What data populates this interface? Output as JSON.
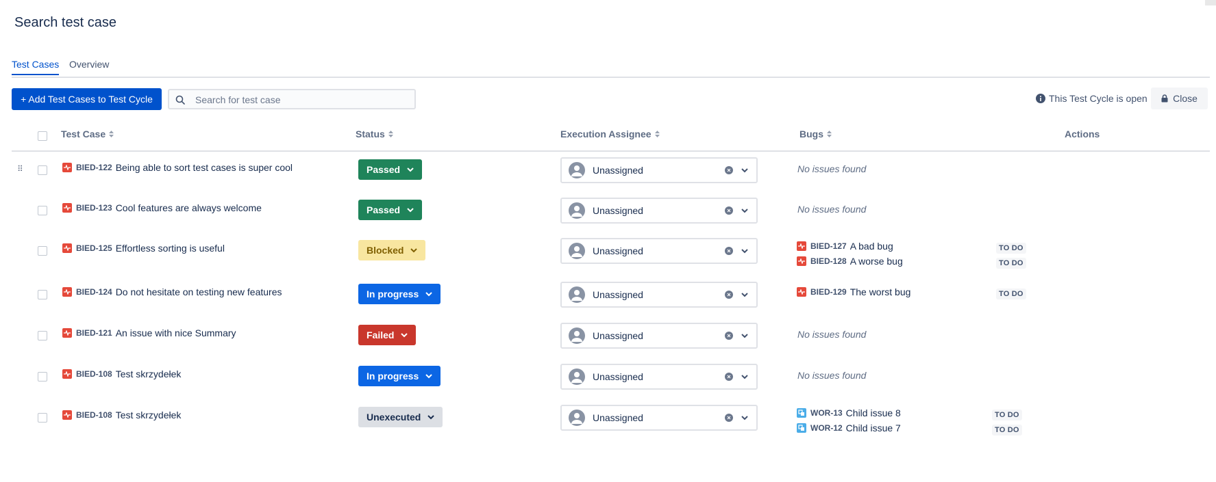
{
  "page": {
    "title": "Search test case"
  },
  "tabs": [
    {
      "label": "Test Cases",
      "active": true
    },
    {
      "label": "Overview",
      "active": false
    }
  ],
  "toolbar": {
    "add_label": "+ Add Test Cases to Test Cycle",
    "search_placeholder": "Search for test case",
    "cycle_status": "This Test Cycle is open",
    "close_label": "Close"
  },
  "columns": {
    "test_case": "Test Case",
    "status": "Status",
    "assignee": "Execution Assignee",
    "bugs": "Bugs",
    "actions": "Actions"
  },
  "colors": {
    "primary": "#0052cc",
    "passed": "#1f845a",
    "blocked": "#f8e6a0",
    "in_progress": "#0c66e4",
    "failed": "#c9372c",
    "unexecuted": "#dcdfe4",
    "bug_icon": "#e5493a",
    "task_icon": "#4bade8"
  },
  "icons": {
    "search": "search-icon",
    "info": "info-icon",
    "lock": "lock-icon",
    "sort": "sort-icon",
    "drag": "drag-handle-icon",
    "bug": "bug-icon",
    "task": "task-icon",
    "chevron": "chevron-down-icon",
    "clear": "clear-icon",
    "avatar": "user-avatar-icon"
  },
  "rows": [
    {
      "key": "BIED-122",
      "summary": "Being able to sort test cases is super cool",
      "status": "Passed",
      "assignee": "Unassigned",
      "no_issues": "No issues found",
      "bugs": []
    },
    {
      "key": "BIED-123",
      "summary": "Cool features are always welcome",
      "status": "Passed",
      "assignee": "Unassigned",
      "no_issues": "No issues found",
      "bugs": []
    },
    {
      "key": "BIED-125",
      "summary": "Effortless sorting is useful",
      "status": "Blocked",
      "assignee": "Unassigned",
      "bugs": [
        {
          "key": "BIED-127",
          "summary": "A bad bug",
          "status": "TO DO"
        },
        {
          "key": "BIED-128",
          "summary": "A worse bug",
          "status": "TO DO"
        }
      ]
    },
    {
      "key": "BIED-124",
      "summary": "Do not hesitate on testing new features",
      "status": "In progress",
      "assignee": "Unassigned",
      "bugs": [
        {
          "key": "BIED-129",
          "summary": "The worst bug",
          "status": "TO DO"
        }
      ]
    },
    {
      "key": "BIED-121",
      "summary": "An issue with nice Summary",
      "status": "Failed",
      "assignee": "Unassigned",
      "no_issues": "No issues found",
      "bugs": []
    },
    {
      "key": "BIED-108",
      "summary": "Test skrzydełek",
      "status": "In progress",
      "assignee": "Unassigned",
      "no_issues": "No issues found",
      "bugs": []
    },
    {
      "key": "BIED-108",
      "summary": "Test skrzydełek",
      "status": "Unexecuted",
      "assignee": "Unassigned",
      "bugs": [
        {
          "key": "WOR-13",
          "summary": "Child issue 8",
          "status": "TO DO"
        },
        {
          "key": "WOR-12",
          "summary": "Child issue 7",
          "status": "TO DO"
        }
      ]
    }
  ]
}
